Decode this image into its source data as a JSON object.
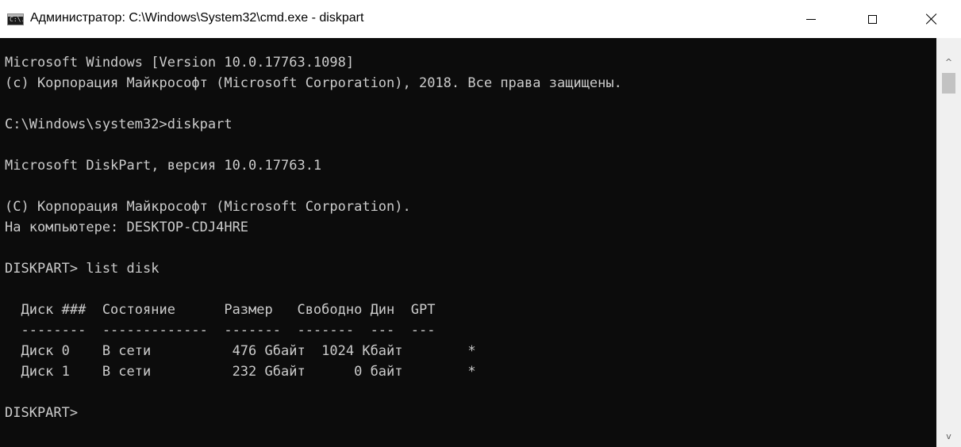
{
  "window": {
    "title": "Администратор: C:\\Windows\\System32\\cmd.exe - diskpart",
    "icon": "cmd-console-icon",
    "icon_text": "C:\\.",
    "controls": {
      "minimize": "minimize-icon",
      "maximize": "maximize-icon",
      "close": "close-icon"
    }
  },
  "console": {
    "background": "#0c0c0c",
    "foreground": "#cccccc",
    "lines": [
      "Microsoft Windows [Version 10.0.17763.1098]",
      "(c) Корпорация Майкрософт (Microsoft Corporation), 2018. Все права защищены.",
      "",
      "C:\\Windows\\system32>diskpart",
      "",
      "Microsoft DiskPart, версия 10.0.17763.1",
      "",
      "(C) Корпорация Майкрософт (Microsoft Corporation).",
      "На компьютере: DESKTOP-CDJ4HRE",
      "",
      "DISKPART> list disk",
      "",
      "  Диск ###  Состояние      Размер   Свободно Дин  GPT",
      "  --------  -------------  -------  -------  ---  ---",
      "  Диск 0    В сети          476 Gбайт  1024 Kбайт        *",
      "  Диск 1    В сети          232 Gбайт      0 байт        *",
      "",
      "DISKPART> "
    ]
  },
  "scrollbar": {
    "up_icon": "scroll-up-arrow-icon",
    "down_icon": "scroll-down-arrow-icon",
    "up_glyph": "^",
    "down_glyph": "v"
  }
}
